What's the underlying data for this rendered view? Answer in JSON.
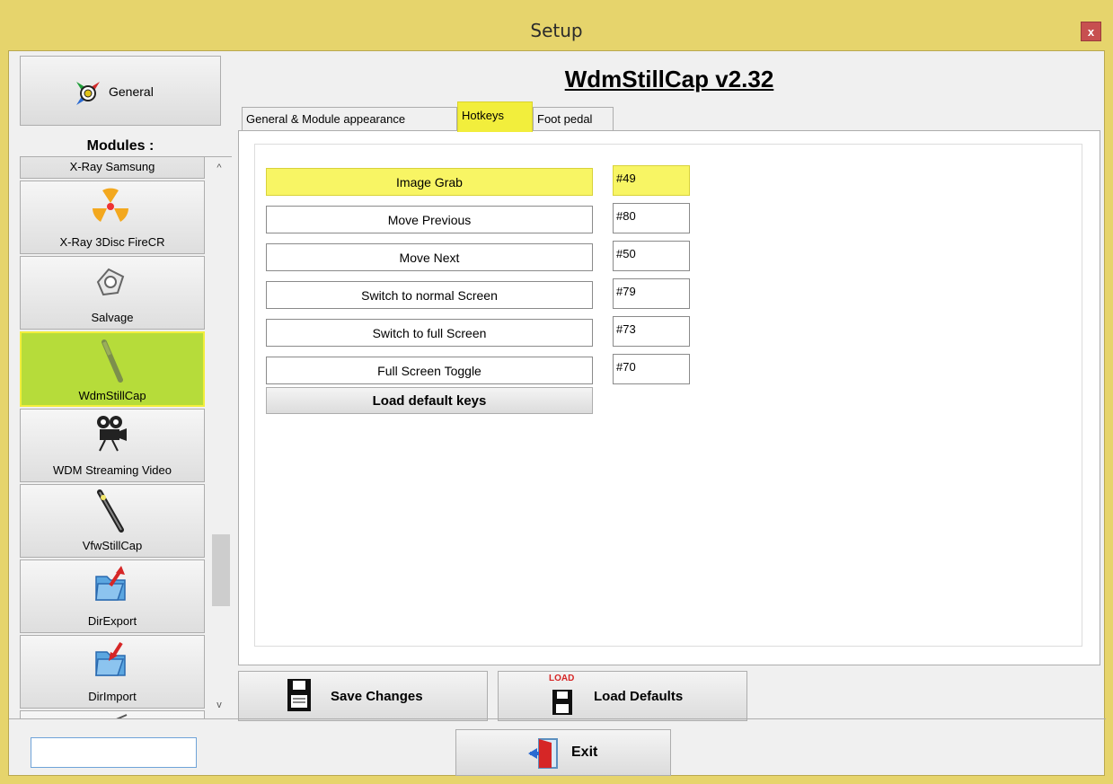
{
  "window": {
    "title": "Setup",
    "close_label": "x"
  },
  "left": {
    "general_label": "General",
    "modules_label": "Modules :",
    "modules": [
      {
        "label": "X-Ray Samsung",
        "icon": "xray-samsung-icon"
      },
      {
        "label": "X-Ray 3Disc FireCR",
        "icon": "radiation-icon"
      },
      {
        "label": "Salvage",
        "icon": "puzzle-icon"
      },
      {
        "label": "WdmStillCap",
        "icon": "dental-camera-icon",
        "active": true
      },
      {
        "label": "WDM Streaming Video",
        "icon": "movie-camera-icon"
      },
      {
        "label": "VfwStillCap",
        "icon": "intraoral-camera-icon"
      },
      {
        "label": "DirExport",
        "icon": "folder-export-icon"
      },
      {
        "label": "DirImport",
        "icon": "folder-import-icon"
      },
      {
        "label": "",
        "icon": "pen-icon"
      }
    ],
    "scroll_up": "^",
    "scroll_down": "v"
  },
  "main": {
    "app_title": "WdmStillCap v2.32",
    "tabs": [
      {
        "label": "General & Module appearance"
      },
      {
        "label": "Hotkeys",
        "active": true
      },
      {
        "label": "Foot pedal"
      }
    ],
    "hotkeys": [
      {
        "action": "Image Grab",
        "key": "#49",
        "highlighted": true
      },
      {
        "action": "Move Previous",
        "key": "#80"
      },
      {
        "action": "Move Next",
        "key": "#50"
      },
      {
        "action": "Switch to normal Screen",
        "key": "#79"
      },
      {
        "action": "Switch to full Screen",
        "key": "#73"
      },
      {
        "action": "Full Screen Toggle",
        "key": "#70"
      }
    ],
    "load_default_keys": "Load default keys",
    "save_changes": "Save Changes",
    "load_defaults": "Load Defaults",
    "load_icon_text": "LOAD"
  },
  "bottom": {
    "input_value": "",
    "exit_label": "Exit"
  },
  "colors": {
    "titlebar": "#e6d46c",
    "highlight": "#f8f564",
    "active_module": "#b6dc3a",
    "close": "#c75050"
  }
}
